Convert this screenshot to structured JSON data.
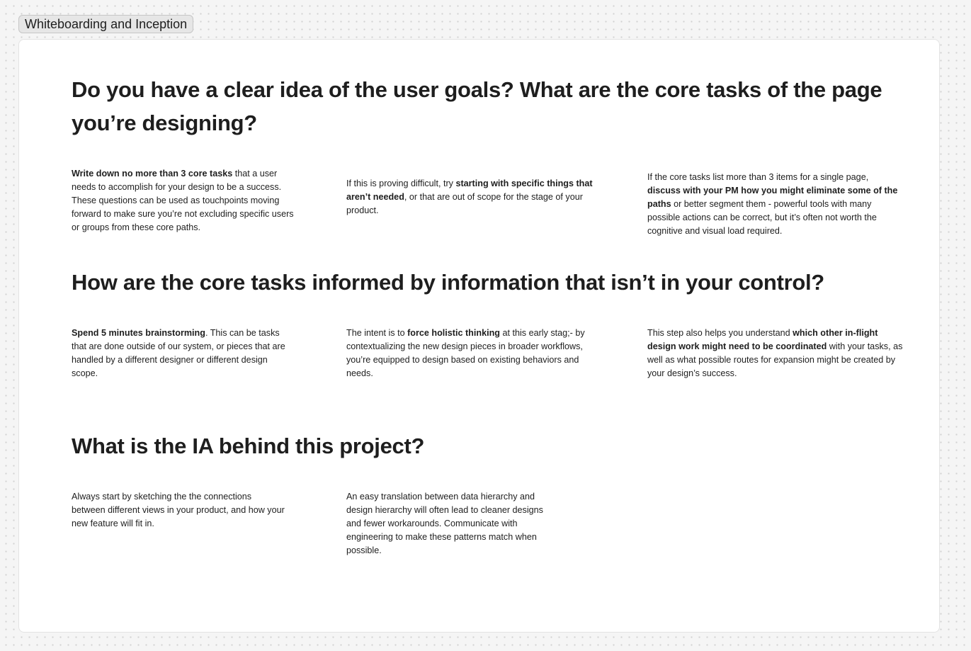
{
  "frame": {
    "label": "Whiteboarding and Inception"
  },
  "sections": [
    {
      "heading": "Do you have a clear idea of the user goals? What are the core tasks of the page you’re designing?",
      "columns": [
        {
          "bold": "Write down no more than 3 core tasks",
          "after": " that a user needs to accomplish for your design to be a success. These questions can be used as touchpoints moving forward to make sure you’re not excluding specific users or groups from these core paths."
        },
        {
          "before": "If this is proving difficult, try ",
          "bold": "starting with specific things that aren’t needed",
          "after": ", or that are out of scope for the stage of your product."
        },
        {
          "before": "If the core tasks list more than 3 items for a single page, ",
          "bold": "discuss with your PM how you might eliminate some of the paths",
          "after": " or better segment them - powerful tools with many possible actions can be correct, but it’s often not worth the cognitive and visual load required."
        }
      ]
    },
    {
      "heading": "How are the core tasks informed by information that isn’t in your control?",
      "columns": [
        {
          "bold": "Spend 5 minutes brainstorming",
          "after": ". This can be tasks that are done outside of our system, or pieces that are handled by a different designer or different design scope."
        },
        {
          "before": "The intent is to ",
          "bold": "force holistic thinking",
          "after": " at this early stag;- by contextualizing the new design pieces in broader workflows, you’re equipped to design based on existing behaviors and needs."
        },
        {
          "before": "This step also helps you understand ",
          "bold": "which other in-flight design work might need to be coordinated",
          "after": " with your tasks, as well as what possible routes for expansion might be created by your design’s success."
        }
      ]
    },
    {
      "heading": "What is the IA behind this project?",
      "columns": [
        {
          "before": "Always start by sketching the the connections between different views in your product, and how your new feature will fit in."
        },
        {
          "before": "An easy translation between data hierarchy and design hierarchy will often lead to cleaner designs and fewer workarounds. Communicate with engineering to make these patterns match when possible."
        }
      ]
    }
  ]
}
